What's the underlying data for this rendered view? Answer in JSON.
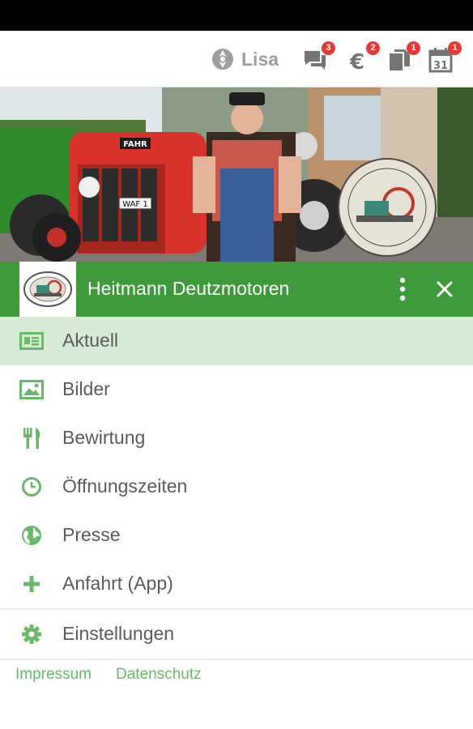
{
  "topbar": {
    "username": "Lisa",
    "icons": [
      {
        "name": "messages-icon",
        "badge": "3"
      },
      {
        "name": "euro-icon",
        "badge": "2"
      },
      {
        "name": "documents-icon",
        "badge": "1"
      },
      {
        "name": "calendar-icon",
        "badge": "1",
        "calendar_day": "31"
      }
    ]
  },
  "drawer": {
    "title": "Heitmann Deutzmotoren",
    "accent_color": "#3f9a3c",
    "active_bg": "#d7ead6"
  },
  "hero": {
    "plate_text": "FAHR",
    "license_plate": "WAF 1"
  },
  "menu": {
    "items": [
      {
        "label": "Aktuell",
        "icon": "newspaper-icon",
        "active": true
      },
      {
        "label": "Bilder",
        "icon": "image-icon"
      },
      {
        "label": "Bewirtung",
        "icon": "fork-knife-icon"
      },
      {
        "label": "Öffnungszeiten",
        "icon": "clock-icon"
      },
      {
        "label": "Presse",
        "icon": "globe-icon"
      },
      {
        "label": "Anfahrt (App)",
        "icon": "plus-icon"
      },
      {
        "label": "Einstellungen",
        "icon": "gear-icon"
      }
    ]
  },
  "footer": {
    "impressum": "Impressum",
    "datenschutz": "Datenschutz"
  }
}
